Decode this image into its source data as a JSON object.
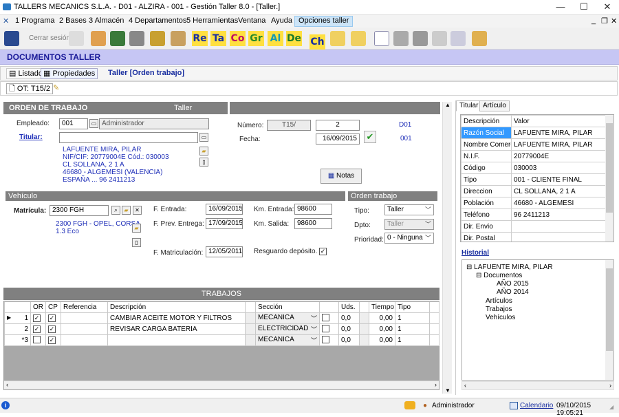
{
  "window": {
    "title": "TALLERS MECANICS S.L.A. - D01 - ALZIRA - 001 - Gestión Taller 8.0 - [Taller.]"
  },
  "menu": [
    "1 Programa",
    "2 Bases",
    "3 Almacén",
    "4 Departamentos",
    "5 Herramientas",
    "Ventana",
    "Ayuda",
    "Opciones taller"
  ],
  "toolbar": {
    "cerrar_sesion": "Cerrar sesión",
    "text_buttons": [
      "Re",
      "Ta",
      "Co",
      "Gr",
      "Al",
      "De",
      "Ch"
    ]
  },
  "page_title": "DOCUMENTOS TALLER",
  "tabs": {
    "listado": "Listado",
    "propiedades": "Propiedades",
    "context": "Taller [Orden trabajo]",
    "ot": "OT: T15/2"
  },
  "orden": {
    "header": "ORDEN DE TRABAJO",
    "header_right": "Taller",
    "empleado_label": "Empleado:",
    "empleado_code": "001",
    "empleado_name": "Administrador",
    "titular_label": "Titular:",
    "titular_value": "",
    "cliente": {
      "nombre": "LAFUENTE MIRA, PILAR",
      "nif": "NIF/CIF: 20779004E   Cód.: 030003",
      "direccion": "CL SOLLANA, 2 1 A",
      "poblacion": "46680 - ALGEMESI (VALENCIA)",
      "pais": "ESPAÑA ... 96 2411213"
    },
    "numero_label": "Número:",
    "serie": "T15/",
    "numero": "2",
    "numero_code": "D01",
    "fecha_label": "Fecha:",
    "fecha": "16/09/2015",
    "fecha_code": "001",
    "notas": "Notas"
  },
  "vehiculo": {
    "header": "Vehículo",
    "matricula_label": "Matrícula:",
    "matricula": "2300 FGH",
    "desc1": "2300 FGH - OPEL, CORSA",
    "desc2": "1.3 Eco",
    "f_entrada_label": "F. Entrada:",
    "f_entrada": "16/09/2015",
    "f_prev_label": "F. Prev. Entrega:",
    "f_prev": "17/09/2015",
    "f_matric_label": "F. Matriculación:",
    "f_matric": "12/05/2011",
    "km_entrada_label": "Km. Entrada:",
    "km_entrada": "98600",
    "km_salida_label": "Km. Salida:",
    "km_salida": "98600",
    "resguardo_label": "Resguardo depósito."
  },
  "orden_trabajo": {
    "header": "Orden trabajo",
    "tipo_label": "Tipo:",
    "tipo": "Taller",
    "dpto_label": "Dpto:",
    "dpto": "Taller",
    "prioridad_label": "Prioridad:",
    "prioridad": "0 - Ninguna"
  },
  "trabajos": {
    "header": "TRABAJOS",
    "columns": [
      "OR",
      "CP",
      "Referencia",
      "Descripción",
      "Sección",
      "Uds.",
      "Tiempo",
      "Tipo"
    ],
    "rows": [
      {
        "num": "1",
        "or": true,
        "cp": true,
        "ref": "",
        "desc": "CAMBIAR ACEITE MOTOR Y FILTROS",
        "seccion": "MECANICA",
        "uds": "0,0",
        "tiempo": "0,00",
        "tipo": "1"
      },
      {
        "num": "2",
        "or": true,
        "cp": true,
        "ref": "",
        "desc": "REVISAR CARGA BATERIA",
        "seccion": "ELECTRICIDAD",
        "uds": "0,0",
        "tiempo": "0,00",
        "tipo": "1"
      },
      {
        "num": "*3",
        "or": false,
        "cp": true,
        "ref": "",
        "desc": "",
        "seccion": "MECANICA",
        "uds": "0,0",
        "tiempo": "0,00",
        "tipo": "1"
      }
    ]
  },
  "right_panel": {
    "tab_titular": "Titular",
    "tab_articulo": "Artículo",
    "col_desc": "Descripción",
    "col_valor": "Valor",
    "props": [
      {
        "k": "Razón Social",
        "v": "LAFUENTE MIRA, PILAR"
      },
      {
        "k": "Nombre Comercial",
        "v": "LAFUENTE MIRA, PILAR"
      },
      {
        "k": "N.I.F.",
        "v": "20779004E"
      },
      {
        "k": "Código",
        "v": "030003"
      },
      {
        "k": "Tipo",
        "v": "001 - CLIENTE FINAL"
      },
      {
        "k": "Direccion",
        "v": "CL SOLLANA, 2 1 A"
      },
      {
        "k": "Población",
        "v": "46680 - ALGEMESI"
      },
      {
        "k": "Teléfono",
        "v": "96 2411213"
      },
      {
        "k": "Dir. Envio",
        "v": ""
      },
      {
        "k": "Dir. Postal",
        "v": ""
      }
    ],
    "historial_label": "Historial",
    "tree": {
      "root": "LAFUENTE MIRA, PILAR",
      "documentos": "Documentos",
      "y2015": "AÑO 2015",
      "y2014": "AÑO 2014",
      "articulos": "Artículos",
      "trabajos": "Trabajos",
      "vehiculos": "Vehículos"
    }
  },
  "status": {
    "user": "Administrador",
    "calendario": "Calendario",
    "datetime": "09/10/2015 19:05:21"
  }
}
